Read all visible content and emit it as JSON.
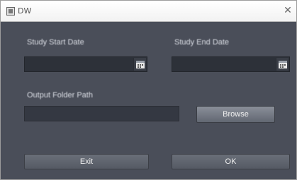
{
  "window": {
    "title": "DW",
    "close_glyph": "✕"
  },
  "form": {
    "start_date_label": "Study Start Date",
    "start_date_value": "",
    "end_date_label": "Study End Date",
    "end_date_value": "",
    "output_folder_label": "Output Folder Path",
    "output_folder_value": "",
    "browse_label": "Browse",
    "cancel_label": "Exit",
    "ok_label": "OK"
  },
  "icons": {
    "calendar": "calendar-icon",
    "close": "close-icon",
    "app": "app-icon"
  },
  "colors": {
    "background": "#4a4e59",
    "field": "#2d3139",
    "button": "#7a7f89"
  }
}
